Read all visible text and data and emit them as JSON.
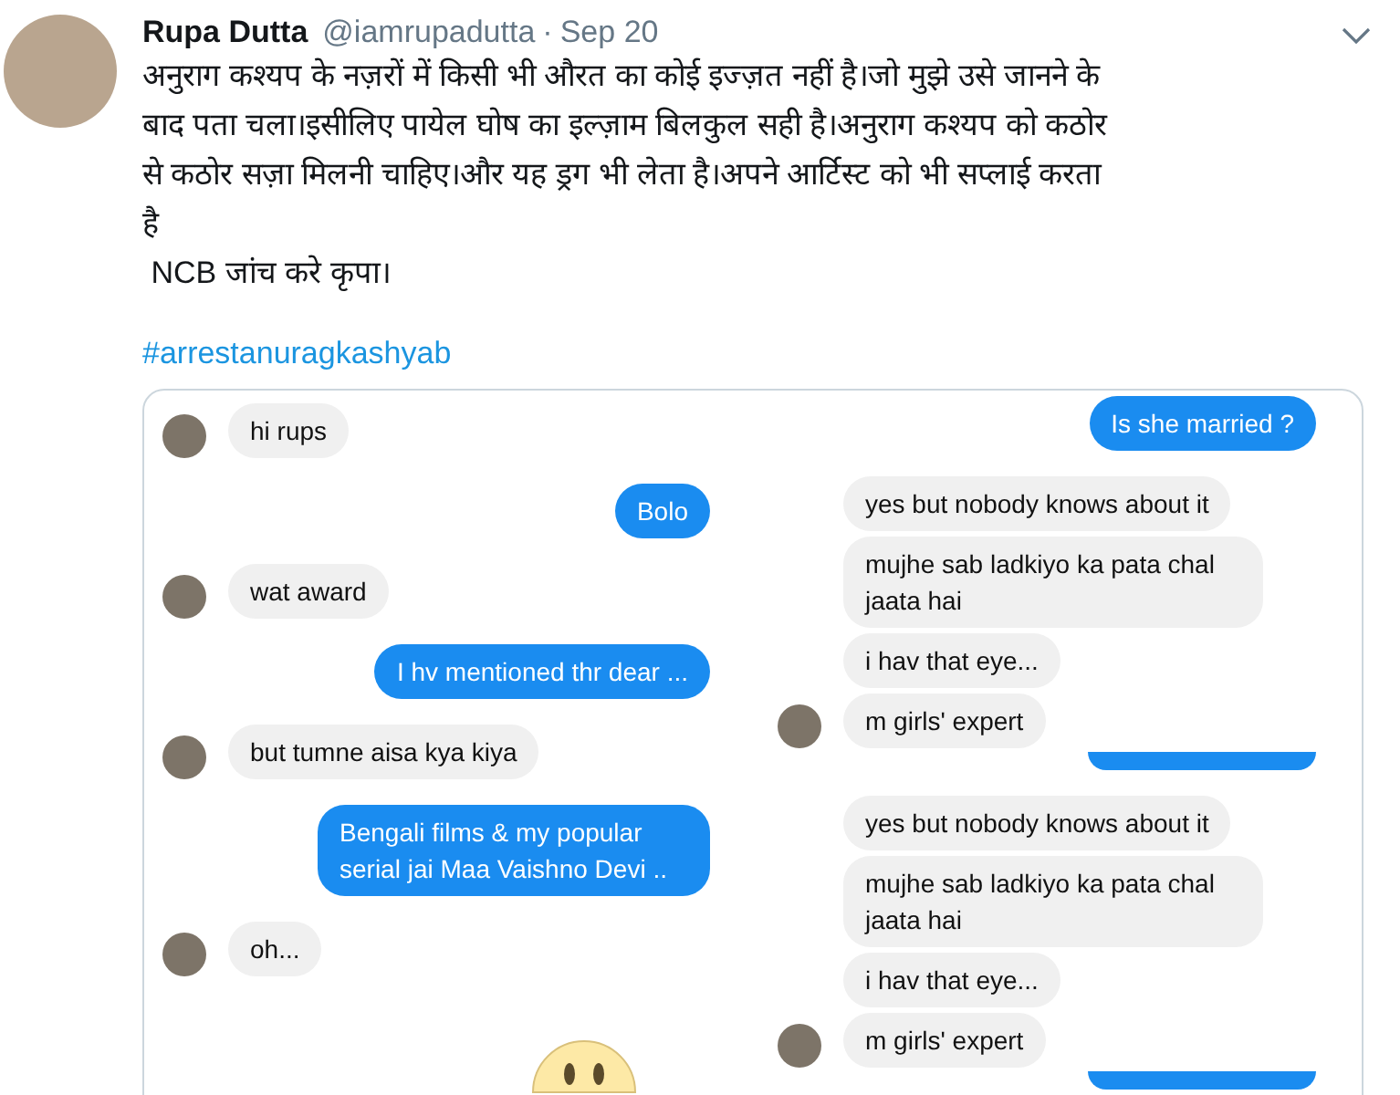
{
  "tweet": {
    "name": "Rupa Dutta",
    "handle": "@iamrupadutta",
    "separator": "·",
    "date": "Sep 20",
    "text_lines": [
      "अनुराग कश्यप के नज़रों में किसी भी औरत का कोई इज्ज़त नहीं है।जो मुझे उसे जानने के",
      "बाद पता चला।इसीलिए पायेल घोष का इल्ज़ाम बिलकुल सही है।अनुराग कश्यप को कठोर",
      "से कठोर सज़ा मिलनी चाहिए।और यह ड्रग भी लेता है।अपने आर्टिस्ट को भी सप्लाई करता",
      "है",
      " NCB जांच करे कृपा।"
    ],
    "hashtag": "#arrestanuragkashyab"
  },
  "chat_screenshot": {
    "left": [
      {
        "kind": "received",
        "text": "hi rups",
        "avatar": true
      },
      {
        "kind": "sent",
        "text": "Bolo"
      },
      {
        "kind": "received",
        "text": "wat award",
        "avatar": true
      },
      {
        "kind": "sent",
        "text": "I hv mentioned thr dear ..."
      },
      {
        "kind": "received",
        "text": "but tumne aisa kya kiya",
        "avatar": true
      },
      {
        "kind": "sent",
        "text": "Bengali films & my popular serial jai Maa Vaishno Devi .."
      },
      {
        "kind": "received",
        "text": "oh...",
        "avatar": true
      },
      {
        "kind": "emoji"
      }
    ],
    "right": [
      {
        "kind": "sent",
        "text": "Is she married ?"
      },
      {
        "kind": "received",
        "text": "yes  but nobody knows about it",
        "avatar": false
      },
      {
        "kind": "received",
        "text": "mujhe sab ladkiyo ka pata chal jaata hai",
        "avatar": false
      },
      {
        "kind": "received",
        "text": "i hav that eye...",
        "avatar": false
      },
      {
        "kind": "received",
        "text": "m girls' expert",
        "avatar": true
      },
      {
        "kind": "fragment"
      },
      {
        "kind": "received",
        "text": "yes  but nobody knows about it",
        "avatar": false
      },
      {
        "kind": "received",
        "text": "mujhe sab ladkiyo ka pata chal jaata hai",
        "avatar": false
      },
      {
        "kind": "received",
        "text": "i hav that eye...",
        "avatar": false
      },
      {
        "kind": "received",
        "text": "m girls' expert",
        "avatar": true
      },
      {
        "kind": "fragment"
      }
    ]
  }
}
